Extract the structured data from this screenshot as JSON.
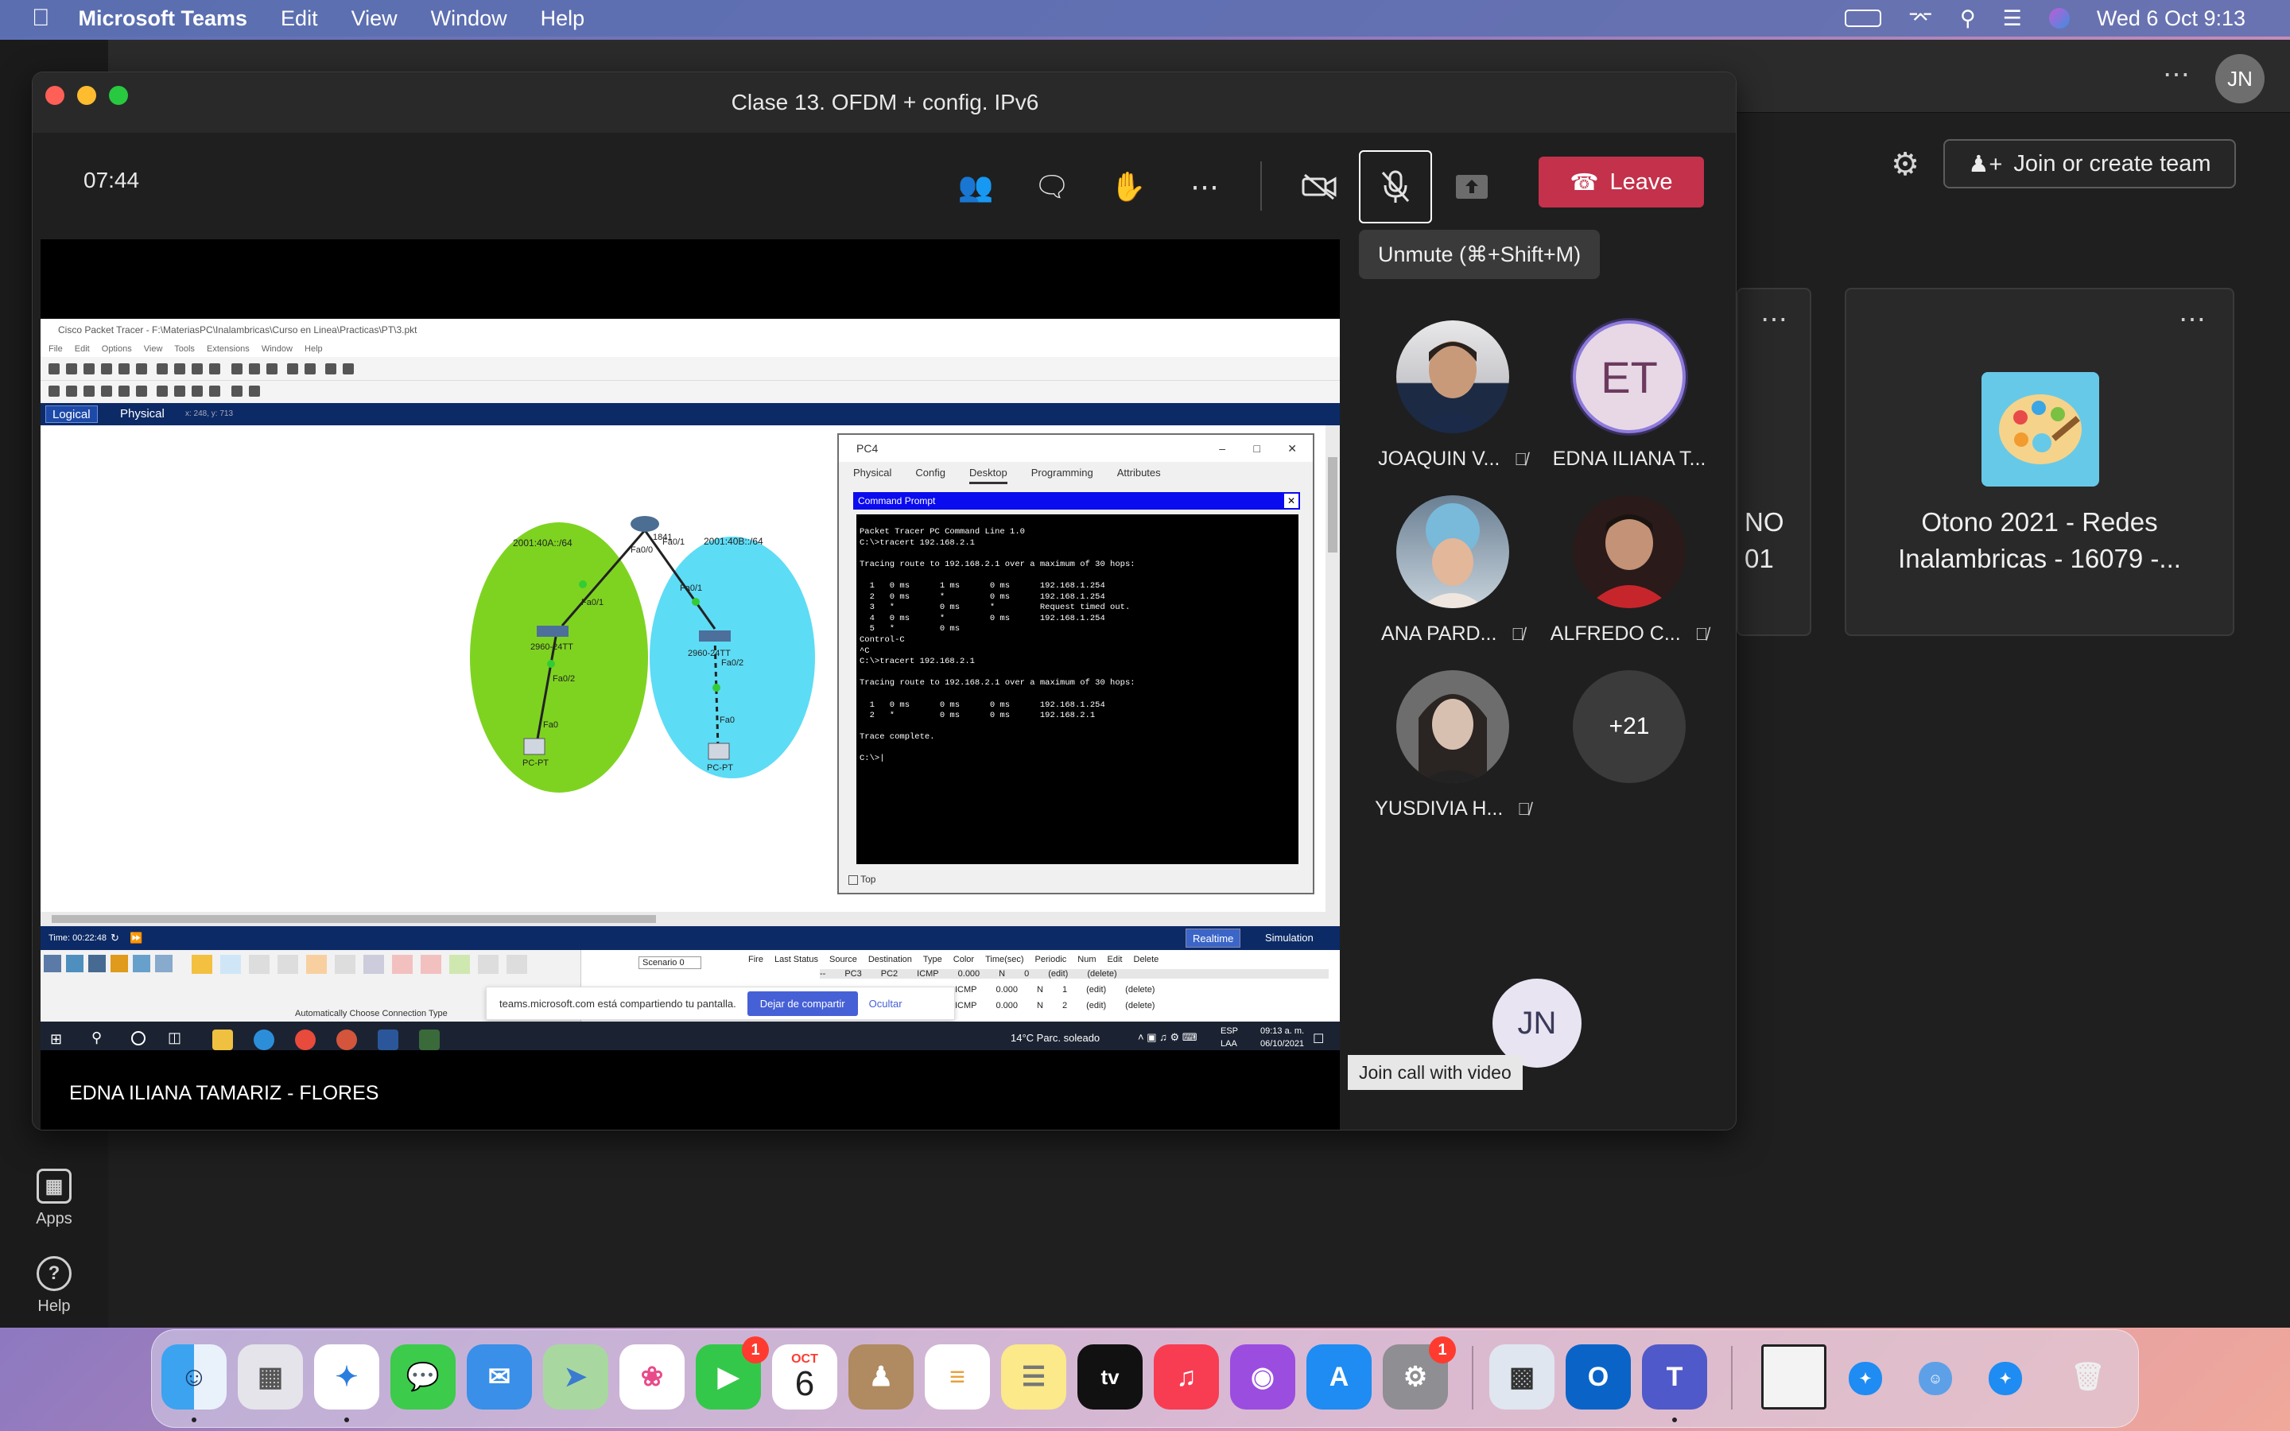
{
  "menubar": {
    "app_name": "Microsoft Teams",
    "items": [
      "Edit",
      "View",
      "Window",
      "Help"
    ],
    "datetime": "Wed 6 Oct  9:13"
  },
  "teams": {
    "rail": [
      {
        "label": "Apps",
        "icon": "apps-icon"
      },
      {
        "label": "Help",
        "icon": "help-icon"
      }
    ],
    "join_create_label": "Join or create team",
    "cards": [
      {
        "title_line1": "NO",
        "title_line2": "01"
      },
      {
        "title_line1": "Otono 2021 - Redes",
        "title_line2": "Inalambricas - 16079 -..."
      }
    ]
  },
  "meeting": {
    "title": "Clase 13. OFDM + config. IPv6",
    "timer": "07:44",
    "leave_label": "Leave",
    "unmute_tooltip": "Unmute (⌘+Shift+M)",
    "presenter_name": "EDNA ILIANA TAMARIZ - FLORES",
    "join_video_tooltip": "Join call with video",
    "self_initials": "JN",
    "participants": [
      {
        "name": "JOAQUIN V...",
        "muted": true,
        "initials": ""
      },
      {
        "name": "EDNA ILIANA T...",
        "muted": false,
        "initials": "ET"
      },
      {
        "name": "ANA PARD...",
        "muted": true,
        "initials": ""
      },
      {
        "name": "ALFREDO C...",
        "muted": true,
        "initials": ""
      },
      {
        "name": "YUSDIVIA H...",
        "muted": true,
        "initials": ""
      }
    ],
    "more_count": "+21"
  },
  "shared_screen": {
    "pt_title": "Cisco Packet Tracer - F:\\MateriasPC\\Inalambricas\\Curso en Linea\\Practicas\\PT\\3.pkt",
    "pt_menu": "File Edit Options View Tools Extensions Window Help",
    "logical_label": "Logical",
    "physical_label": "Physical",
    "coords": "x: 248, y: 713",
    "net_left": "2001:40A::/64",
    "net_right": "2001:40B::/64",
    "router_label": "1841",
    "labels": {
      "fa00": "Fa0/0",
      "fa01_r": "Fa0/1",
      "fa01_l": "Fa0/1",
      "fa01_b": "Fa0/1",
      "switch_l": "2960-24TT",
      "switch_r": "2960-24TT",
      "fa02_l": "Fa0/2",
      "fa02_r": "Fa0/2",
      "fa0_l": "Fa0",
      "fa0_r": "Fa0",
      "pc_l": "PC-PT",
      "pc_r": "PC-PT"
    },
    "pc4": {
      "title": "PC4",
      "tabs": [
        "Physical",
        "Config",
        "Desktop",
        "Programming",
        "Attributes"
      ],
      "cmd_title": "Command Prompt",
      "console": "Packet Tracer PC Command Line 1.0\nC:\\>tracert 192.168.2.1\n\nTracing route to 192.168.2.1 over a maximum of 30 hops:\n\n  1   0 ms      1 ms      0 ms      192.168.1.254\n  2   0 ms      *         0 ms      192.168.1.254\n  3   *         0 ms      *         Request timed out.\n  4   0 ms      *         0 ms      192.168.1.254\n  5   *         0 ms\nControl-C\n^C\nC:\\>tracert 192.168.2.1\n\nTracing route to 192.168.2.1 over a maximum of 30 hops:\n\n  1   0 ms      0 ms      0 ms      192.168.1.254\n  2   *         0 ms      0 ms      192.168.2.1\n\nTrace complete.\n\nC:\\>|",
      "top_label": "Top"
    },
    "time_label": "Time: 00:22:48",
    "realtime_label": "Realtime",
    "simulation_label": "Simulation",
    "scenario": "Scenario 0",
    "conn_type": "Automatically Choose Connection Type",
    "pdu_headers": [
      "Fire",
      "Last Status",
      "Source",
      "Destination",
      "Type",
      "Color",
      "Time(sec)",
      "Periodic",
      "Num",
      "Edit",
      "Delete"
    ],
    "pdu_rows": [
      [
        "",
        "--",
        "PC3",
        "PC2",
        "ICMP",
        "",
        "0.000",
        "N",
        "0",
        "(edit)",
        "(delete)"
      ],
      [
        "",
        "",
        "",
        "",
        "ICMP",
        "",
        "0.000",
        "N",
        "1",
        "(edit)",
        "(delete)"
      ],
      [
        "",
        "",
        "",
        "",
        "ICMP",
        "",
        "0.000",
        "N",
        "2",
        "(edit)",
        "(delete)"
      ]
    ],
    "share_text": "teams.microsoft.com está compartiendo tu pantalla.",
    "share_stop": "Dejar de compartir",
    "share_hide": "Ocultar",
    "weather": "14°C  Parc. soleado",
    "lang": "ESP",
    "lang2": "LAA",
    "win_time": "09:13 a. m.",
    "win_date": "06/10/2021"
  },
  "dock": {
    "calendar_month": "OCT",
    "calendar_day": "6",
    "facetime_badge": "1",
    "settings_badge": "1"
  },
  "colors": {
    "leave": "#c4314b",
    "teams_bg": "#1f1f1f",
    "pt_blue": "#0c2a66",
    "net_green": "#7ed321",
    "net_cyan": "#5ddcf5"
  }
}
